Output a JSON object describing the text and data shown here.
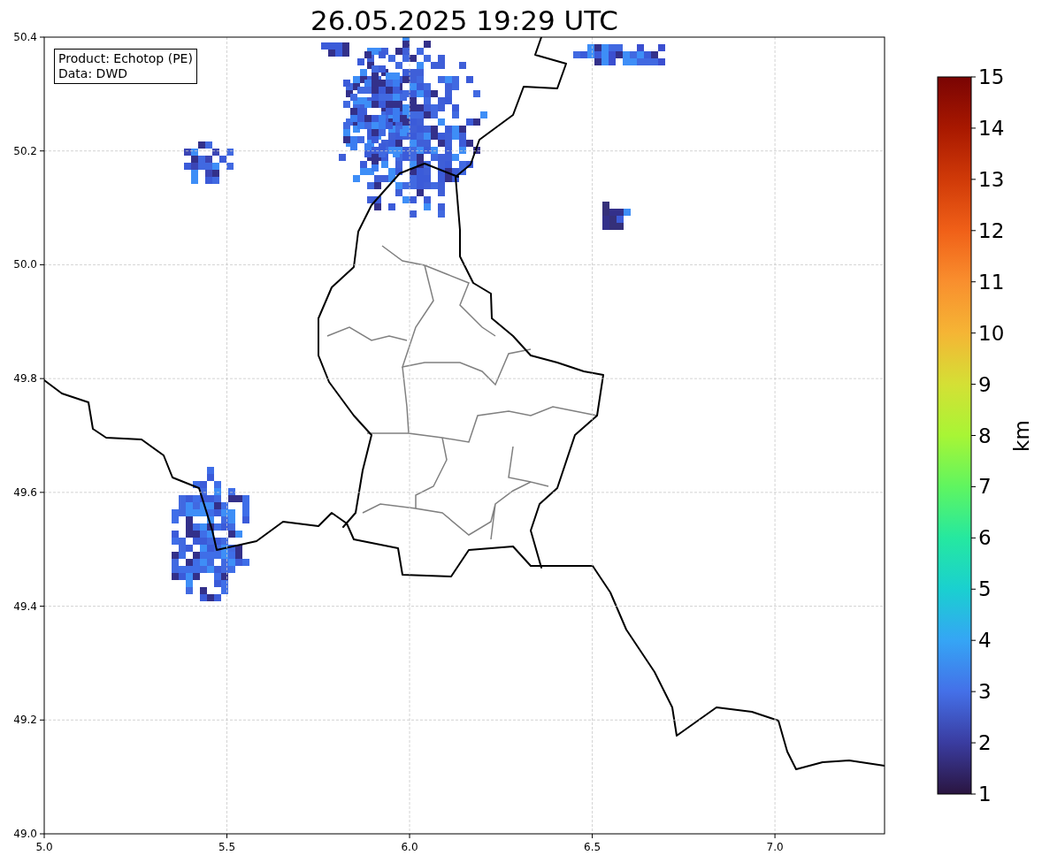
{
  "title": "26.05.2025 19:29 UTC",
  "map": {
    "info_lines": [
      "Product: Echotop (PE)",
      "Data: DWD"
    ],
    "x_ticks": [
      "5.0",
      "5.5",
      "6.0",
      "6.5",
      "7.0"
    ],
    "y_ticks": [
      "50.4",
      "50.2",
      "50.0",
      "49.8",
      "49.6",
      "49.4",
      "49.2",
      "49.0"
    ]
  },
  "colorbar": {
    "label": "km",
    "ticks": [
      "15",
      "14",
      "13",
      "12",
      "11",
      "10",
      "9",
      "8",
      "7",
      "6",
      "5",
      "4",
      "3",
      "2",
      "1"
    ]
  }
}
